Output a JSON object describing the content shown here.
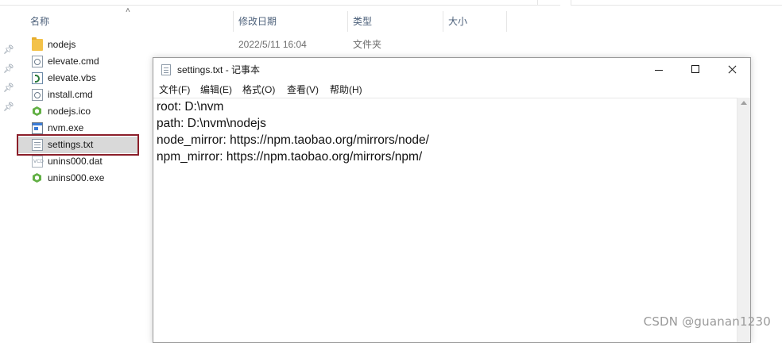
{
  "explorer": {
    "columns": {
      "name": "名称",
      "date": "修改日期",
      "type": "类型",
      "size": "大小"
    },
    "files": [
      {
        "name": "nodejs",
        "icon": "folder-icon",
        "date": "2022/5/11 16:04",
        "type": "文件夹"
      },
      {
        "name": "elevate.cmd",
        "icon": "cmd-file-icon"
      },
      {
        "name": "elevate.vbs",
        "icon": "vbs-script-icon"
      },
      {
        "name": "install.cmd",
        "icon": "cmd-file-icon"
      },
      {
        "name": "nodejs.ico",
        "icon": "nodejs-hex-icon"
      },
      {
        "name": "nvm.exe",
        "icon": "exe-file-icon"
      },
      {
        "name": "settings.txt",
        "icon": "text-file-icon",
        "selected": true
      },
      {
        "name": "unins000.dat",
        "icon": "dat-file-icon"
      },
      {
        "name": "unins000.exe",
        "icon": "nodejs-hex-icon"
      }
    ],
    "highlight_color": "#8b1f2a"
  },
  "notepad": {
    "title": "settings.txt - 记事本",
    "menu": [
      "文件(F)",
      "编辑(E)",
      "格式(O)",
      "查看(V)",
      "帮助(H)"
    ],
    "lines": [
      "root: D:\\nvm",
      "path: D:\\nvm\\nodejs",
      "node_mirror: https://npm.taobao.org/mirrors/node/",
      "npm_mirror: https://npm.taobao.org/mirrors/npm/"
    ]
  },
  "watermark": "CSDN @guanan1230"
}
